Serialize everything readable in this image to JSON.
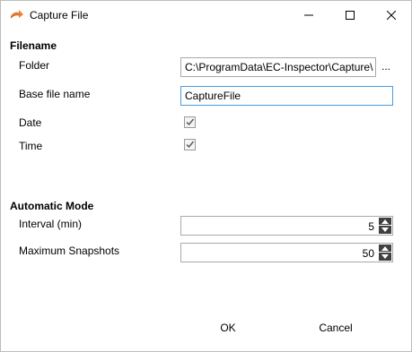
{
  "window": {
    "title": "Capture File",
    "icon": "arrow-capture-icon"
  },
  "filename_section": {
    "heading": "Filename",
    "folder_label": "Folder",
    "folder_value": "C:\\ProgramData\\EC-Inspector\\Capture\\",
    "browse_label": "...",
    "base_name_label": "Base file name",
    "base_name_value": "CaptureFile",
    "date_label": "Date",
    "date_checked": true,
    "time_label": "Time",
    "time_checked": true
  },
  "automatic_section": {
    "heading": "Automatic Mode",
    "interval_label": "Interval (min)",
    "interval_value": "5",
    "max_snapshots_label": "Maximum Snapshots",
    "max_snapshots_value": "50"
  },
  "buttons": {
    "ok_label": "OK",
    "cancel_label": "Cancel"
  },
  "colors": {
    "focus_border": "#4a9de0",
    "icon_orange": "#e8843a"
  }
}
